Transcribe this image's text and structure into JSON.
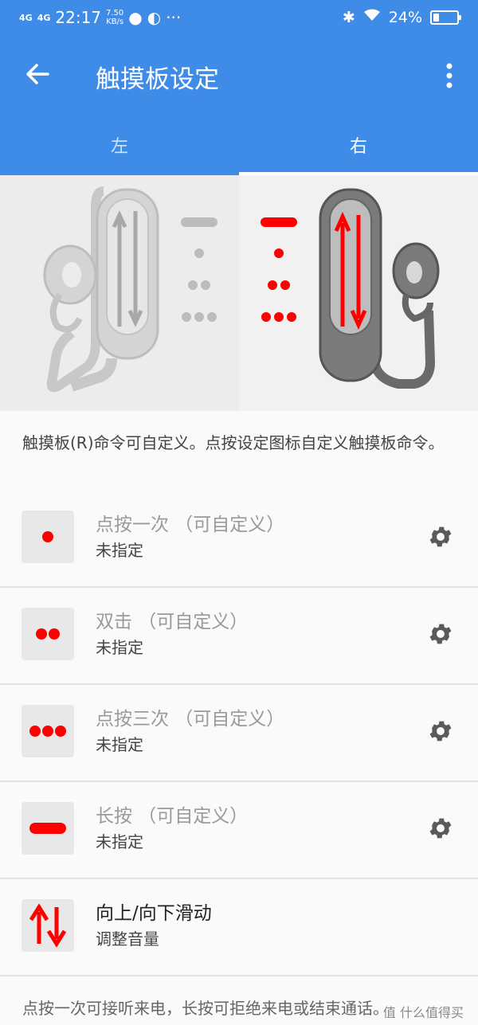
{
  "status_bar": {
    "signal1": "4G",
    "signal2": "4G",
    "time": "22:17",
    "speed_value": "7.50",
    "speed_unit": "KB/s",
    "battery": "24%",
    "battery_level": 0.24
  },
  "toolbar": {
    "title": "触摸板设定"
  },
  "tabs": [
    {
      "label": "左",
      "active": false
    },
    {
      "label": "右",
      "active": true
    }
  ],
  "description": "触摸板(R)命令可自定义。点按设定图标自定义触摸板命令。",
  "commands": [
    {
      "title": "点按一次 （可自定义）",
      "subtitle": "未指定",
      "icon": "single-dot-icon"
    },
    {
      "title": "双击 （可自定义）",
      "subtitle": "未指定",
      "icon": "double-dot-icon"
    },
    {
      "title": "点按三次 （可自定义）",
      "subtitle": "未指定",
      "icon": "triple-dot-icon"
    },
    {
      "title": "长按 （可自定义）",
      "subtitle": "未指定",
      "icon": "long-press-icon"
    },
    {
      "title": "向上/向下滑动",
      "subtitle": "调整音量",
      "icon": "swipe-up-down-icon"
    }
  ],
  "footer_text": "点按一次可接听来电，长按可拒绝来电或结束通话。",
  "watermark": "值 什么值得买",
  "colors": {
    "primary": "#3f8be8",
    "accent_red": "#ff0000",
    "gear": "#5a5a5a"
  }
}
